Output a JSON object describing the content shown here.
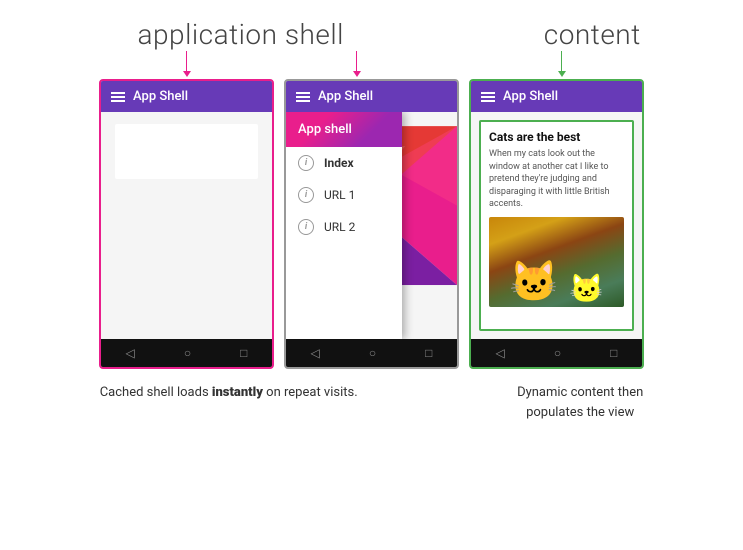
{
  "labels": {
    "application_shell": "application shell",
    "content": "content"
  },
  "phone1": {
    "header_title": "App Shell",
    "type": "shell_only"
  },
  "phone2": {
    "header_title": "App Shell",
    "drawer": {
      "header": "App shell",
      "items": [
        {
          "label": "Index",
          "active": true
        },
        {
          "label": "URL 1",
          "active": false
        },
        {
          "label": "URL 2",
          "active": false
        }
      ]
    }
  },
  "phone3": {
    "header_title": "App Shell",
    "content": {
      "title": "Cats are the best",
      "text": "When my cats look out the window at another cat I like to pretend they're judging and disparaging it with little British accents."
    }
  },
  "captions": {
    "left": "Cached shell loads ",
    "left_bold": "instantly",
    "left_suffix": " on repeat visits.",
    "right_line1": "Dynamic content then",
    "right_line2": "populates the view"
  },
  "nav": {
    "back": "◁",
    "home": "○",
    "recents": "□"
  }
}
